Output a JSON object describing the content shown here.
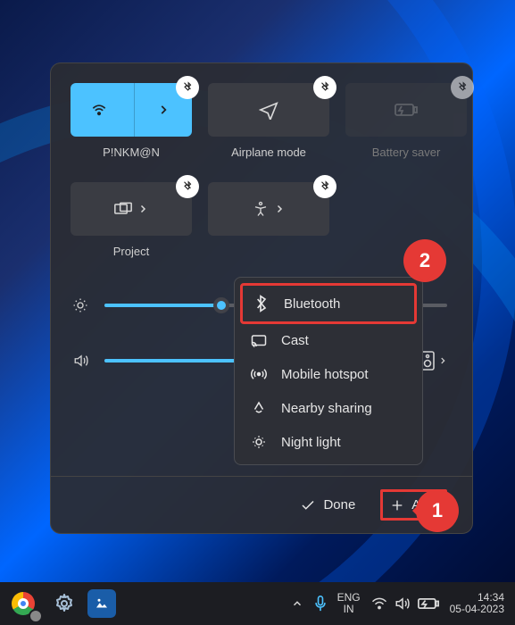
{
  "tiles": {
    "row1": [
      {
        "label": "P!NKM@N",
        "active": true,
        "dim": false
      },
      {
        "label": "Airplane mode",
        "active": false,
        "dim": false
      },
      {
        "label": "Battery saver",
        "active": false,
        "dim": true
      }
    ],
    "row2": [
      {
        "label": "Project",
        "active": false,
        "dim": false
      }
    ]
  },
  "sliders": {
    "brightness_pct": 34,
    "volume_pct": 70
  },
  "footer": {
    "done_label": "Done",
    "add_label": "Add"
  },
  "menu": {
    "items": [
      {
        "label": "Bluetooth"
      },
      {
        "label": "Cast"
      },
      {
        "label": "Mobile hotspot"
      },
      {
        "label": "Nearby sharing"
      },
      {
        "label": "Night light"
      }
    ]
  },
  "callouts": {
    "one": "1",
    "two": "2"
  },
  "taskbar": {
    "lang_top": "ENG",
    "lang_bottom": "IN",
    "time": "14:34",
    "date": "05-04-2023"
  }
}
